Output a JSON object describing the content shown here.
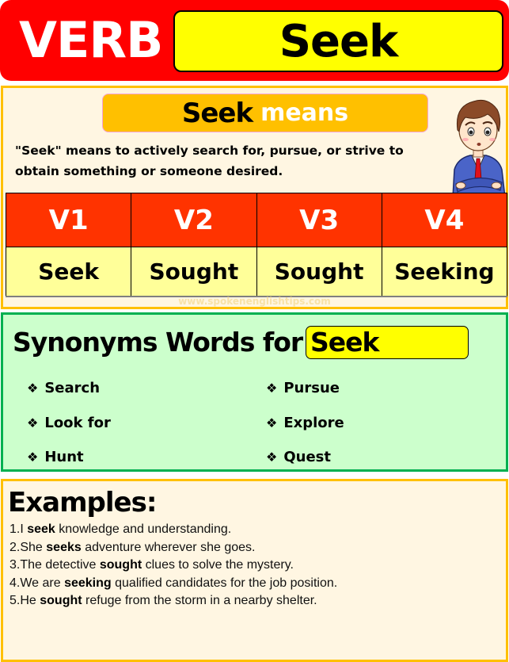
{
  "banner": {
    "label": "VERB",
    "word": "Seek"
  },
  "meaning": {
    "badge_word": "Seek",
    "badge_label": "means",
    "definition": "\"Seek\" means to actively search for, pursue, or strive to obtain something or someone desired.",
    "character_icon": "thinking-man-illustration"
  },
  "forms": {
    "headers": [
      "V1",
      "V2",
      "V3",
      "V4"
    ],
    "values": [
      "Seek",
      "Sought",
      "Sought",
      "Seeking"
    ]
  },
  "watermark": "www.spokenenglishtips.com",
  "synonyms": {
    "title": "Synonyms Words for",
    "word": "Seek",
    "bullet_icon": "four-diamond-bullet-icon",
    "bullet_glyph": "❖",
    "left": [
      "Search",
      "Look for",
      "Hunt"
    ],
    "right": [
      "Pursue",
      "Explore",
      "Quest"
    ]
  },
  "examples": {
    "title": "Examples:",
    "items": [
      {
        "prefix": "1.I ",
        "bold": "seek",
        "suffix": " knowledge and understanding."
      },
      {
        "prefix": "2.She ",
        "bold": "seeks",
        "suffix": " adventure wherever she goes."
      },
      {
        "prefix": "3.The detective ",
        "bold": "sought",
        "suffix": " clues to solve the mystery."
      },
      {
        "prefix": "4.We are ",
        "bold": "seeking",
        "suffix": " qualified candidates for the job position."
      },
      {
        "prefix": "5.He ",
        "bold": "sought",
        "suffix": " refuge from the storm in a nearby shelter."
      }
    ]
  },
  "colors": {
    "banner_red": "#ff0000",
    "highlight_yellow": "#ffff00",
    "panel_gold": "#ffc000",
    "table_header_red": "#ff3300",
    "table_value_yellow": "#ffff99",
    "synonym_green": "#00b050",
    "synonym_bg": "#ccffcc",
    "panel_cream": "#fff6e2"
  }
}
